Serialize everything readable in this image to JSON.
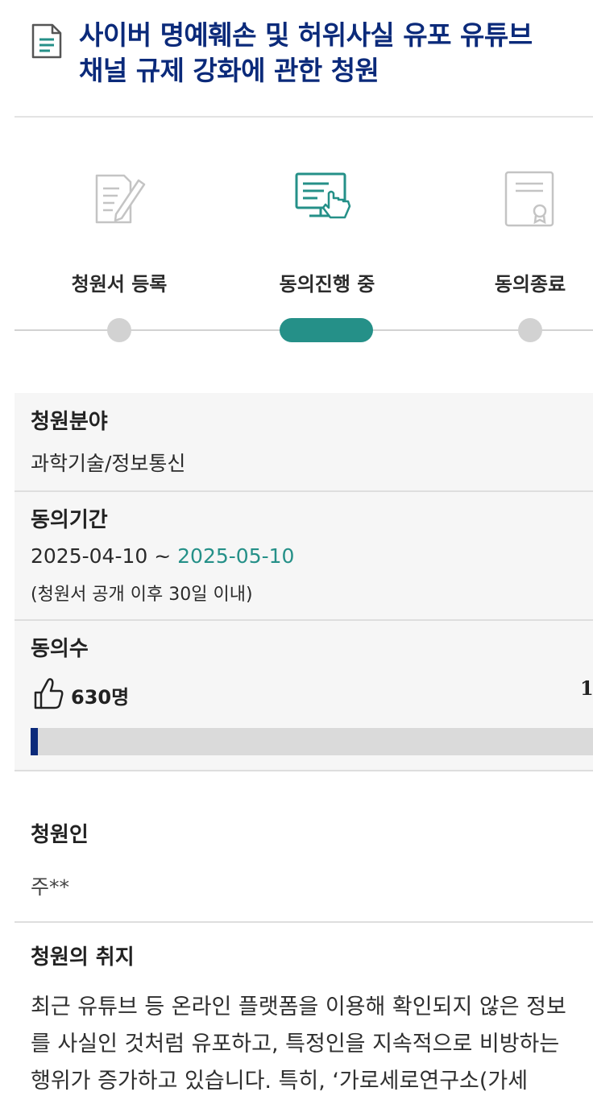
{
  "header": {
    "title_line1": "사이버 명예훼손 및 허위사실 유포 유튜브",
    "title_line2": "채널 규제 강화에 관한 청원",
    "icon": "document-icon"
  },
  "steps": [
    {
      "label": "청원서 등록",
      "icon": "edit-document-icon",
      "active": false
    },
    {
      "label": "동의진행 중",
      "icon": "computer-touch-icon",
      "active": true
    },
    {
      "label": "동의종료",
      "icon": "certificate-icon",
      "active": false
    }
  ],
  "category": {
    "label": "청원분야",
    "value": "과학기술/정보통신"
  },
  "period": {
    "label": "동의기간",
    "start": "2025-04-10",
    "sep": " ~ ",
    "end": "2025-05-10",
    "note": "(청원서 공개 이후 30일 이내)"
  },
  "agree": {
    "label": "동의수",
    "count": "630명",
    "target_fragment": "1",
    "icon": "thumbs-up-icon",
    "progress_fraction": 0.0126
  },
  "petitioner": {
    "label": "청원인",
    "value": "주**"
  },
  "purpose": {
    "label": "청원의 취지",
    "lines": [
      "최근 유튜브 등 온라인 플랫폼을 이용해 확인되지 않은 정보",
      "를 사실인 것처럼 유포하고, 특정인을 지속적으로 비방하는",
      "행위가 증가하고 있습니다. 특히, ‘가로세로연구소(가세"
    ]
  },
  "colors": {
    "navy": "#0b2a7a",
    "teal": "#259088",
    "gray_track": "#d2d2d2"
  }
}
